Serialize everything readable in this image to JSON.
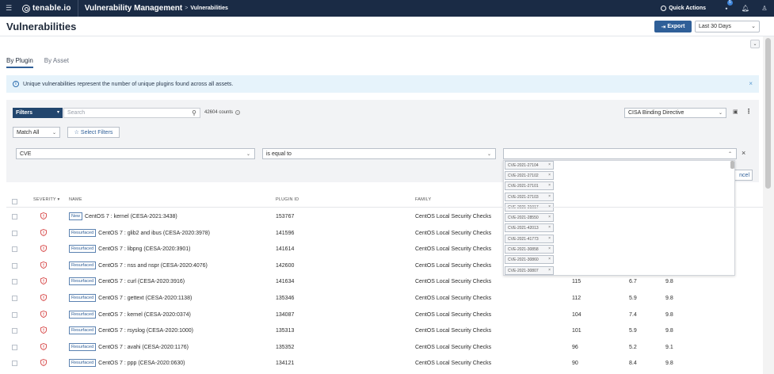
{
  "nav": {
    "logo": "tenable.io",
    "app": "Vulnerability Management",
    "separator": ">",
    "page": "Vulnerabilities",
    "quick_actions": "Quick Actions",
    "notification_count": "5"
  },
  "header": {
    "title": "Vulnerabilities",
    "export_label": "Export",
    "date_range": "Last 30 Days"
  },
  "tabs": [
    {
      "label": "By Plugin",
      "active": true
    },
    {
      "label": "By Asset",
      "active": false
    }
  ],
  "banner": {
    "text": "Unique vulnerabilities represent the number of unique plugins found across all assets."
  },
  "filters": {
    "button_label": "Filters",
    "search_placeholder": "Search",
    "counts": "42604 counts",
    "saved_filter": "CISA Binding Directive",
    "match": "Match All",
    "select_filters": "Select Filters",
    "field": "CVE",
    "operator": "is equal to",
    "cancel_label": "ncel",
    "values": [
      "CVE-2021-27104",
      "CVE-2021-27102",
      "CVE-2021-27101",
      "CVE-2021-27103",
      "CVE-2021-21017",
      "CVE-2021-28550",
      "CVE-2021-42013",
      "CVE-2021-41773",
      "CVE-2021-30858",
      "CVE-2021-30860",
      "CVE-2021-30807"
    ]
  },
  "table": {
    "headers": {
      "severity": "SEVERITY",
      "name": "NAME",
      "plugin_id": "PLUGIN ID",
      "family": "FAMILY"
    },
    "severity_color": "#d64545",
    "rows": [
      {
        "tag": "New",
        "name": "CentOS 7 : kernel (CESA-2021:3438)",
        "plugin_id": "153767",
        "family": "CentOS Local Security Checks",
        "count": "",
        "vpr": "",
        "cvss": ""
      },
      {
        "tag": "Resurfaced",
        "name": "CentOS 7 : glib2 and ibus (CESA-2020:3978)",
        "plugin_id": "141596",
        "family": "CentOS Local Security Checks",
        "count": "",
        "vpr": "",
        "cvss": ""
      },
      {
        "tag": "Resurfaced",
        "name": "CentOS 7 : libpng (CESA-2020:3901)",
        "plugin_id": "141614",
        "family": "CentOS Local Security Checks",
        "count": "",
        "vpr": "",
        "cvss": ""
      },
      {
        "tag": "Resurfaced",
        "name": "CentOS 7 : nss and nspr (CESA-2020:4076)",
        "plugin_id": "142600",
        "family": "CentOS Local Security Checks",
        "count": "",
        "vpr": "",
        "cvss": ""
      },
      {
        "tag": "Resurfaced",
        "name": "CentOS 7 : curl (CESA-2020:3916)",
        "plugin_id": "141634",
        "family": "CentOS Local Security Checks",
        "count": "115",
        "vpr": "6.7",
        "cvss": "9.8"
      },
      {
        "tag": "Resurfaced",
        "name": "CentOS 7 : gettext (CESA-2020:1138)",
        "plugin_id": "135346",
        "family": "CentOS Local Security Checks",
        "count": "112",
        "vpr": "5.9",
        "cvss": "9.8"
      },
      {
        "tag": "Resurfaced",
        "name": "CentOS 7 : kernel (CESA-2020:0374)",
        "plugin_id": "134087",
        "family": "CentOS Local Security Checks",
        "count": "104",
        "vpr": "7.4",
        "cvss": "9.8"
      },
      {
        "tag": "Resurfaced",
        "name": "CentOS 7 : rsyslog (CESA-2020:1000)",
        "plugin_id": "135313",
        "family": "CentOS Local Security Checks",
        "count": "101",
        "vpr": "5.9",
        "cvss": "9.8"
      },
      {
        "tag": "Resurfaced",
        "name": "CentOS 7 : avahi (CESA-2020:1176)",
        "plugin_id": "135352",
        "family": "CentOS Local Security Checks",
        "count": "96",
        "vpr": "5.2",
        "cvss": "9.1"
      },
      {
        "tag": "Resurfaced",
        "name": "CentOS 7 : ppp (CESA-2020:0630)",
        "plugin_id": "134121",
        "family": "CentOS Local Security Checks",
        "count": "90",
        "vpr": "8.4",
        "cvss": "9.8"
      }
    ]
  }
}
